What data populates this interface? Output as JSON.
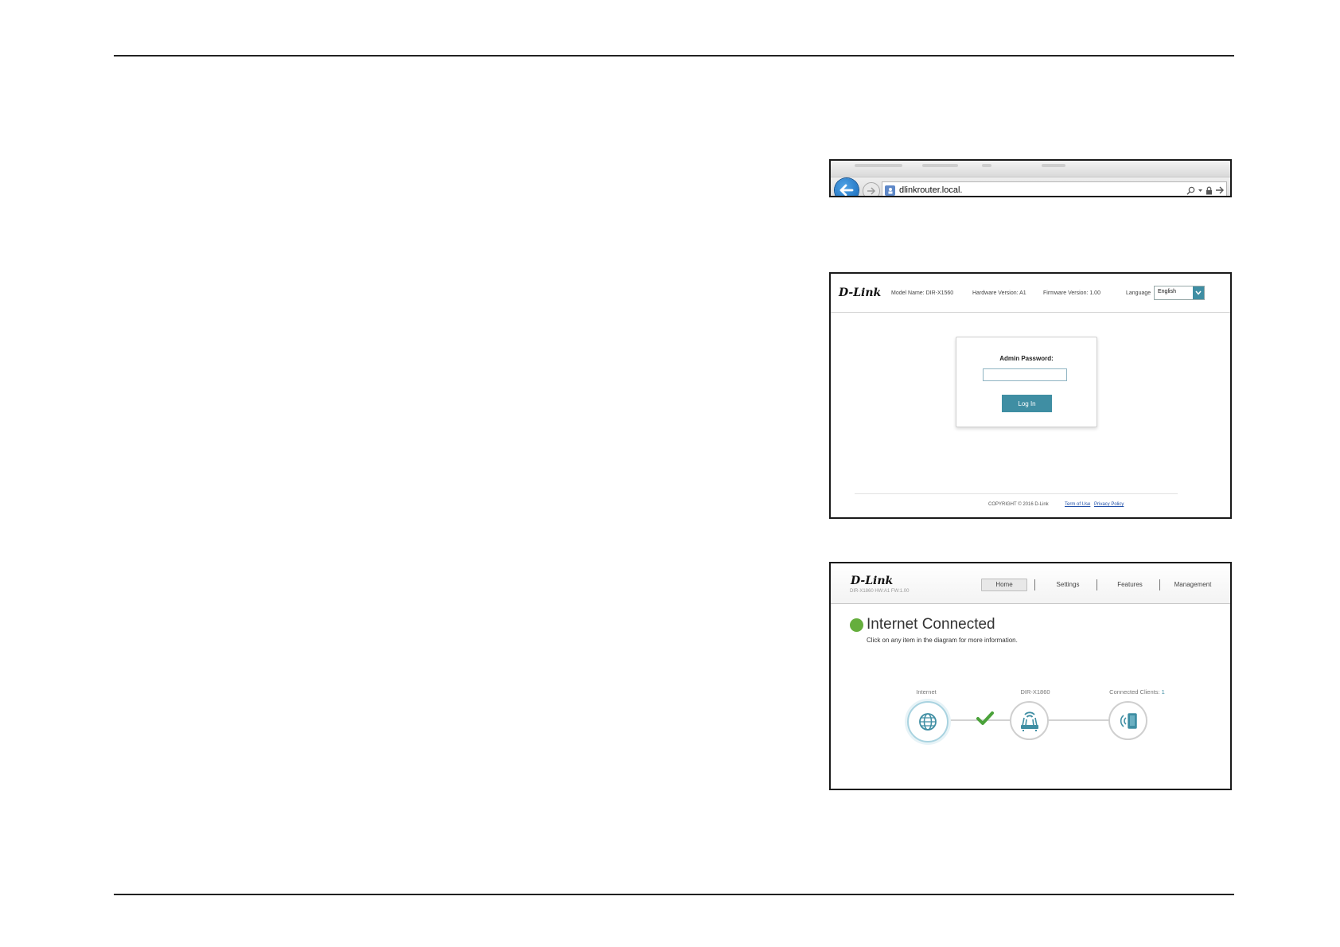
{
  "browser": {
    "url": "dlinkrouter.local."
  },
  "login": {
    "logo": "D-Link",
    "model": "Model Name: DIR-X1560",
    "hardware": "Hardware Version: A1",
    "firmware": "Firmware Version: 1.00",
    "language_label": "Language",
    "language_value": "English",
    "password_label": "Admin Password:",
    "login_button": "Log In",
    "copyright": "COPYRIGHT © 2016 D-Link",
    "terms_link": "Term of Use",
    "privacy_link": "Privacy Policy"
  },
  "home": {
    "logo": "D-Link",
    "subtitle": "DIR-X1860 HW:A1 FW:1.00",
    "nav": [
      "Home",
      "Settings",
      "Features",
      "Management"
    ],
    "active_tab": "Home",
    "status_title": "Internet Connected",
    "status_subtitle": "Click on any item in the diagram for more information.",
    "nodes": {
      "internet_label": "Internet",
      "router_label": "DIR-X1860",
      "clients_label": "Connected Clients:",
      "clients_count": "1"
    }
  },
  "colors": {
    "accent": "#3f8ea3",
    "status_green": "#65ae3d",
    "back_button": "#1f7ad0"
  }
}
